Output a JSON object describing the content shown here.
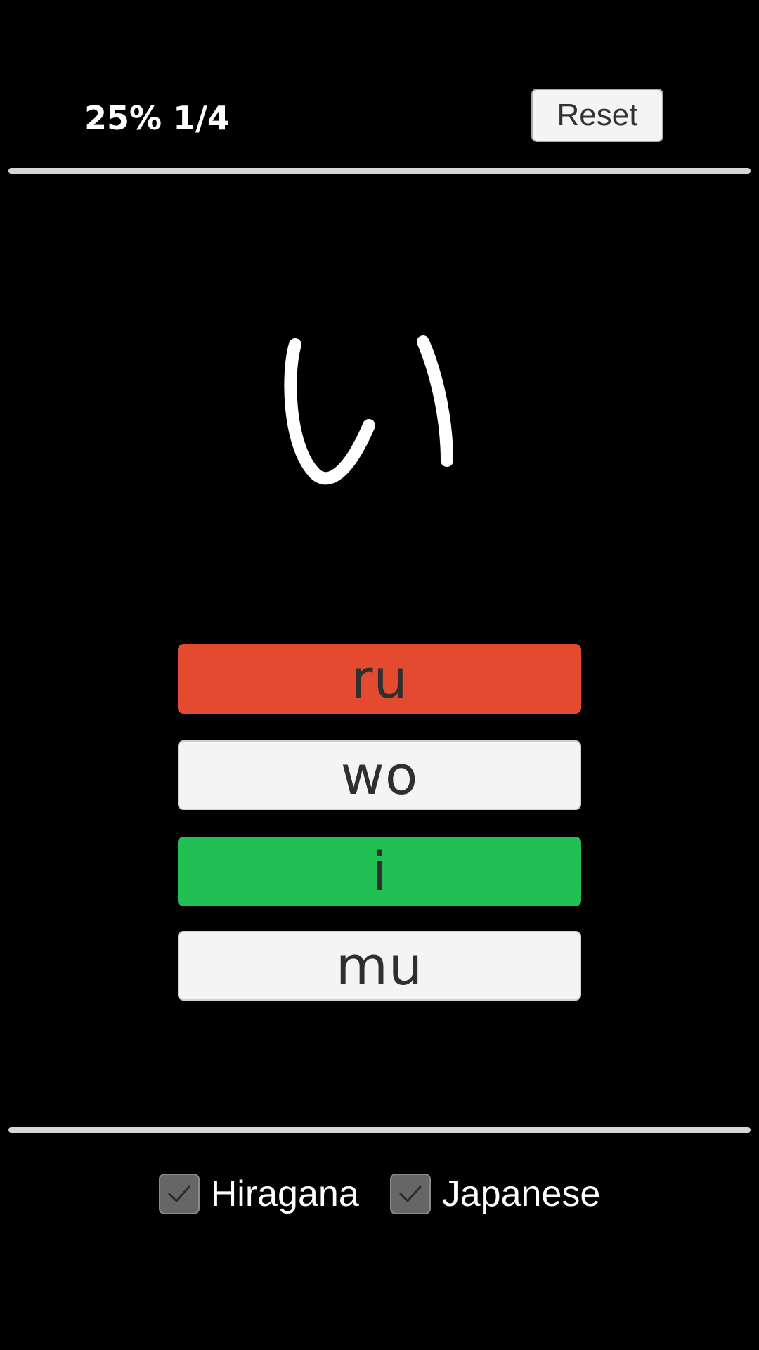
{
  "header": {
    "progress_percent": "25%",
    "progress_count": "1/4",
    "reset_label": "Reset"
  },
  "question": {
    "kana": "い"
  },
  "answers": [
    {
      "label": "ru",
      "state": "wrong"
    },
    {
      "label": "wo",
      "state": "neutral"
    },
    {
      "label": "i",
      "state": "correct"
    },
    {
      "label": "mu",
      "state": "neutral"
    }
  ],
  "options": [
    {
      "label": "Hiragana",
      "checked": true,
      "icon": "check-icon"
    },
    {
      "label": "Japanese",
      "checked": true,
      "icon": "check-icon"
    }
  ],
  "colors": {
    "background": "#000000",
    "wrong": "#e34a2f",
    "correct": "#22bf55",
    "neutral": "#f4f4f4",
    "divider": "#d6d6d6"
  }
}
